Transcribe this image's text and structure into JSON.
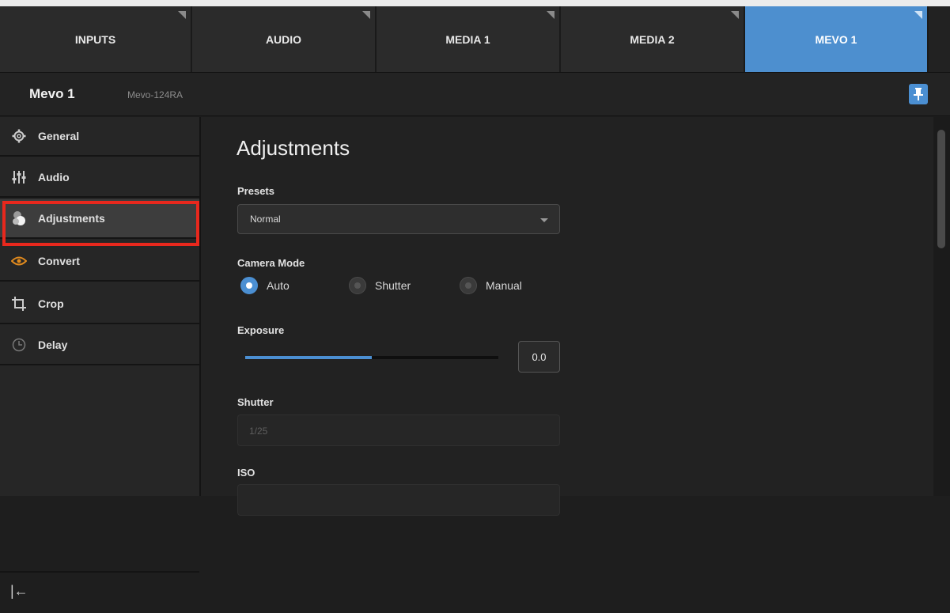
{
  "tabs": [
    {
      "label": "INPUTS",
      "active": false
    },
    {
      "label": "AUDIO",
      "active": false
    },
    {
      "label": "MEDIA 1",
      "active": false
    },
    {
      "label": "MEDIA 2",
      "active": false
    },
    {
      "label": "MEVO 1",
      "active": true
    }
  ],
  "header": {
    "title": "Mevo 1",
    "subtitle": "Mevo-124RA",
    "pin_icon": "pin-icon"
  },
  "sidebar": {
    "items": [
      {
        "label": "General",
        "icon": "gear-icon"
      },
      {
        "label": "Audio",
        "icon": "mixer-sliders-icon"
      },
      {
        "label": "Adjustments",
        "icon": "adjustments-icon",
        "active": true
      },
      {
        "label": "Convert",
        "icon": "convert-eye-icon"
      },
      {
        "label": "Crop",
        "icon": "crop-icon"
      },
      {
        "label": "Delay",
        "icon": "clock-icon"
      }
    ],
    "collapse_glyph": "|←"
  },
  "main": {
    "title": "Adjustments",
    "presets": {
      "label": "Presets",
      "value": "Normal"
    },
    "camera_mode": {
      "label": "Camera Mode",
      "options": [
        "Auto",
        "Shutter",
        "Manual"
      ],
      "selected": "Auto"
    },
    "exposure": {
      "label": "Exposure",
      "value": "0.0",
      "slider_fraction": 0.5
    },
    "shutter": {
      "label": "Shutter",
      "value": "1/25"
    },
    "iso": {
      "label": "ISO"
    }
  },
  "colors": {
    "accent": "#4b8fd2",
    "highlight": "#e8281d"
  }
}
